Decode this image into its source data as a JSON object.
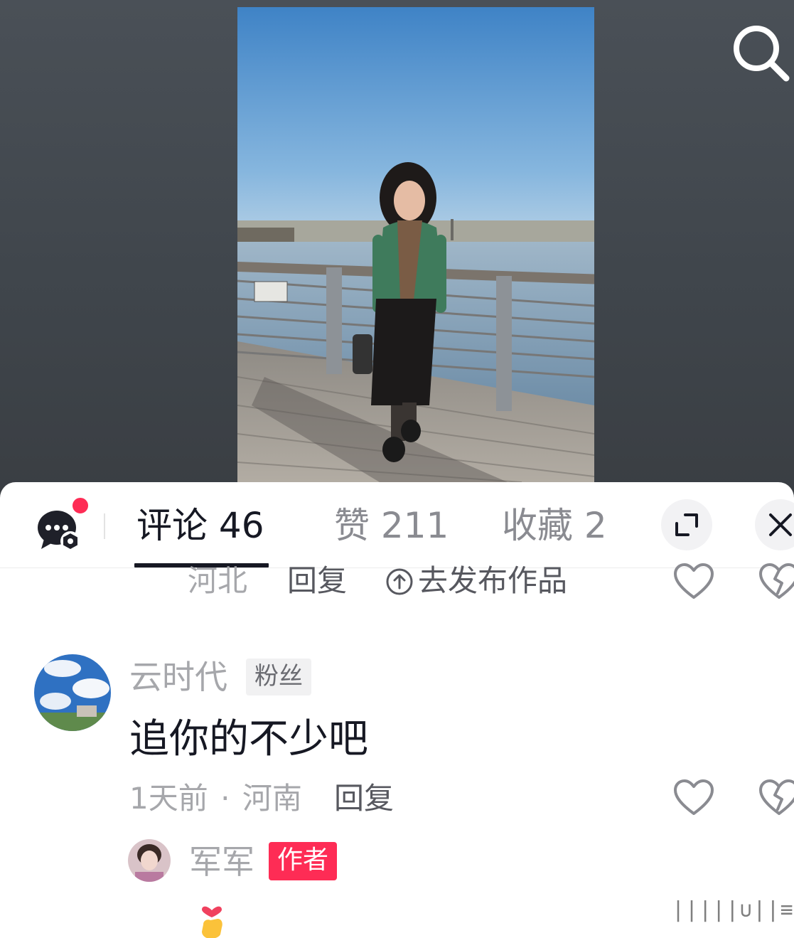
{
  "tabs": {
    "comments": "评论 46",
    "likes": "赞 211",
    "favorites": "收藏 2"
  },
  "prev_comment": {
    "location": "河北",
    "reply": "回复",
    "publish": "去发布作品"
  },
  "comment": {
    "username": "云时代",
    "fan_badge": "粉丝",
    "text": "追你的不少吧",
    "time": "1天前",
    "separator": "·",
    "location": "河南",
    "reply": "回复"
  },
  "reply_preview": {
    "username": "军军",
    "author_badge": "作者"
  },
  "icons": {
    "search": "search-icon",
    "chat": "chat-bubble-icon",
    "expand": "expand-icon",
    "close": "close-icon",
    "like": "heart-icon",
    "dislike": "broken-heart-icon",
    "upload": "upload-circle-icon",
    "emoji": "finger-heart-emoji-icon"
  },
  "colors": {
    "accent": "#fe2c55",
    "text_primary": "#161823",
    "text_secondary": "#a6a7ab"
  }
}
